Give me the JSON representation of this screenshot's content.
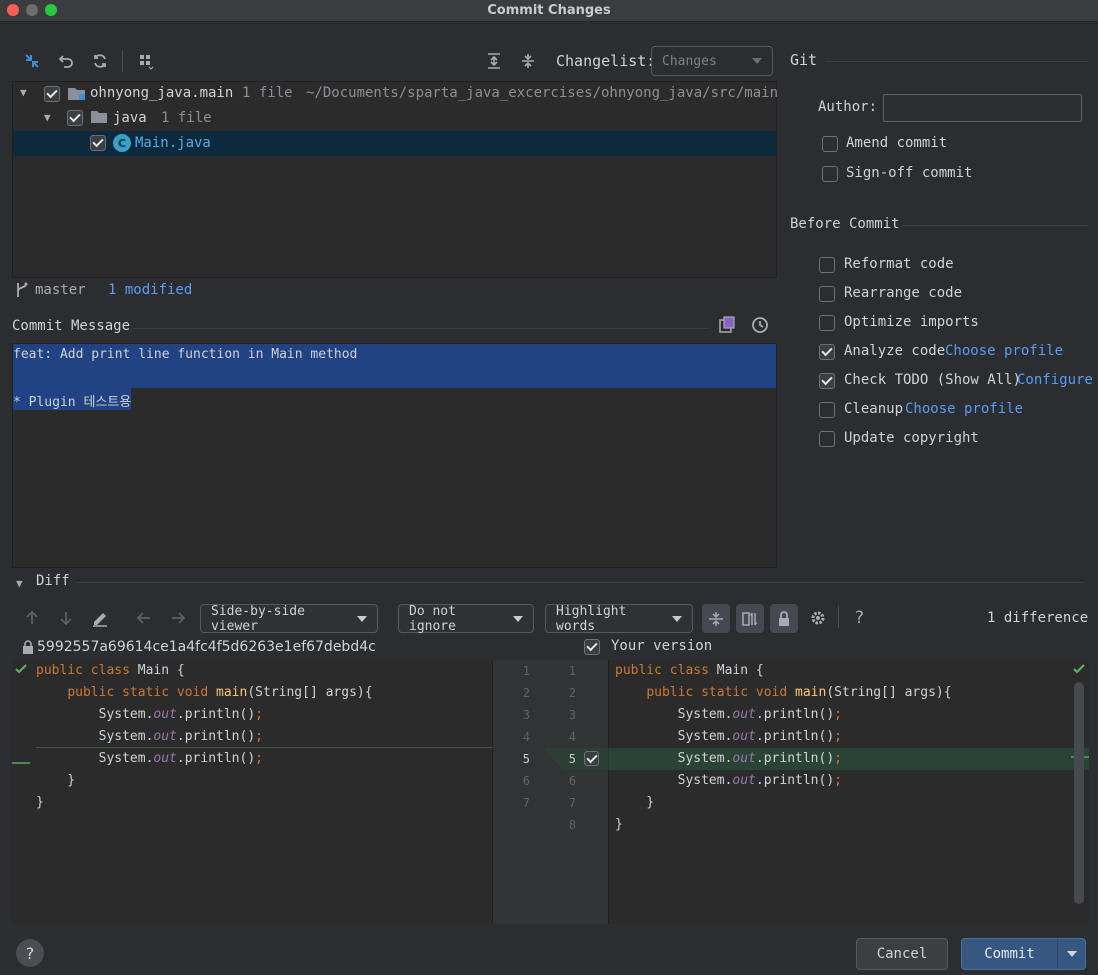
{
  "window": {
    "title": "Commit Changes"
  },
  "toolbar": {
    "changelist_label": "Changelist:",
    "changelist_value": "Changes"
  },
  "tree": {
    "root": {
      "name": "ohnyong_java.main",
      "count": "1 file",
      "path": "~/Documents/sparta_java_excercises/ohnyong_java/src/main"
    },
    "folder": {
      "name": "java",
      "count": "1 file"
    },
    "file": {
      "name": "Main.java"
    }
  },
  "status": {
    "branch": "master",
    "modified": "1 modified"
  },
  "commit_message": {
    "header": "Commit Message",
    "line1": "feat: Add print line function in Main method",
    "line3": "* Plugin 테스트용"
  },
  "git": {
    "header": "Git",
    "author_label": "Author:",
    "author_value": "",
    "amend": "Amend commit",
    "signoff": "Sign-off commit"
  },
  "before_commit": {
    "header": "Before Commit",
    "items": [
      {
        "label": "Reformat code",
        "checked": false,
        "link": ""
      },
      {
        "label": "Rearrange code",
        "checked": false,
        "link": ""
      },
      {
        "label": "Optimize imports",
        "checked": false,
        "link": ""
      },
      {
        "label": "Analyze code",
        "checked": true,
        "link": "Choose profile"
      },
      {
        "label": "Check TODO (Show All)",
        "checked": true,
        "link": "Configure"
      },
      {
        "label": "Cleanup",
        "checked": false,
        "link": "Choose profile"
      },
      {
        "label": "Update copyright",
        "checked": false,
        "link": ""
      }
    ]
  },
  "diff": {
    "header": "Diff",
    "viewer": "Side-by-side viewer",
    "ignore": "Do not ignore",
    "highlight": "Highlight words",
    "help": "?",
    "count": "1 difference",
    "left_title": "5992557a69614ce1a4fc4f5d6263e1ef67debd4c",
    "right_title": "Your version",
    "left_lines": [
      "1",
      "2",
      "3",
      "4",
      "5",
      "6",
      "7"
    ],
    "right_lines": [
      "1",
      "2",
      "3",
      "4",
      "5",
      "6",
      "7",
      "8"
    ]
  },
  "footer": {
    "help": "?",
    "cancel": "Cancel",
    "commit": "Commit"
  }
}
